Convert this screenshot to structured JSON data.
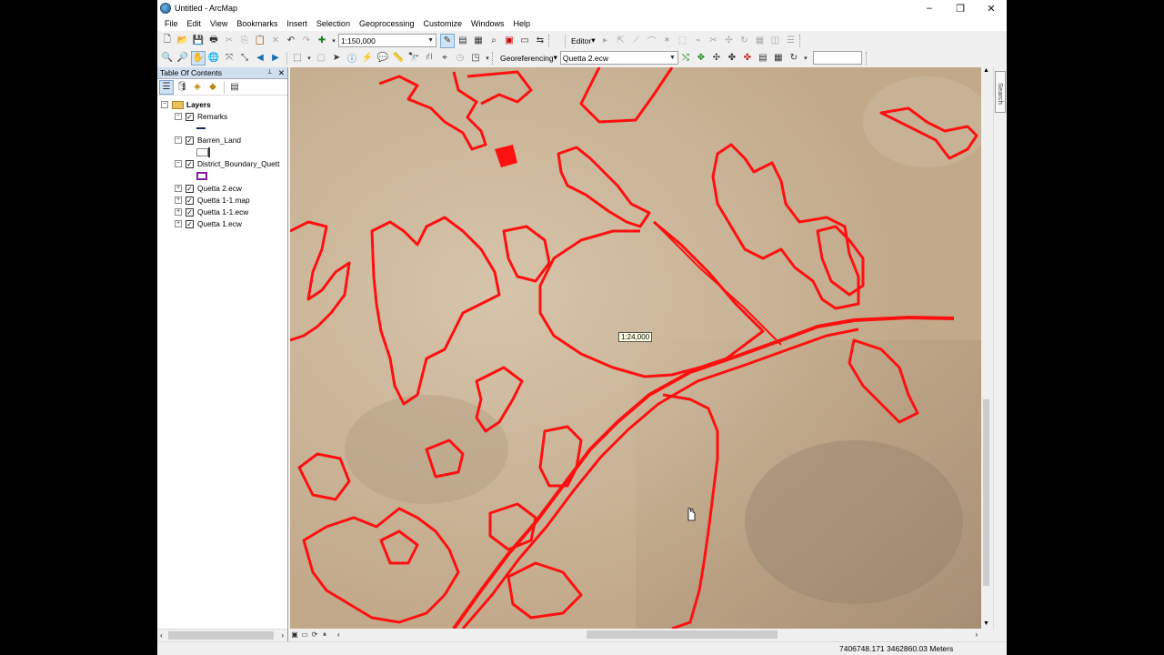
{
  "window": {
    "title": "Untitled - ArcMap",
    "controls": [
      "–",
      "❐",
      "✕"
    ]
  },
  "menu": [
    "File",
    "Edit",
    "View",
    "Bookmarks",
    "Insert",
    "Selection",
    "Geoprocessing",
    "Customize",
    "Windows",
    "Help"
  ],
  "toolbar": {
    "scale_value": "1:150,000",
    "editor_label": "Editor",
    "georeferencing_label": "Georeferencing",
    "layer_value": "Quetta 2.ecw",
    "find_value": ""
  },
  "toc": {
    "title": "Table Of Contents",
    "pin": "📌",
    "close": "✕",
    "root": "Layers",
    "layers": [
      {
        "name": "Remarks",
        "checked": true,
        "expanded": true
      },
      {
        "name": "Barren_Land",
        "checked": true,
        "expanded": true
      },
      {
        "name": "District_Boundary_Quett",
        "checked": true,
        "expanded": true
      },
      {
        "name": "Quetta 2.ecw",
        "checked": true,
        "expanded": false
      },
      {
        "name": "Quetta 1-1.map",
        "checked": true,
        "expanded": false
      },
      {
        "name": "Quetta 1-1.ecw",
        "checked": true,
        "expanded": false
      },
      {
        "name": "Quetta 1.ecw",
        "checked": true,
        "expanded": false
      }
    ]
  },
  "map": {
    "scale_tip": "1:24,000",
    "feature_color": "#ff0000",
    "imagery_color": "#c9b396"
  },
  "search_tab": "Search",
  "status": {
    "coords": "7406748.171  3462860.03 Meters"
  }
}
